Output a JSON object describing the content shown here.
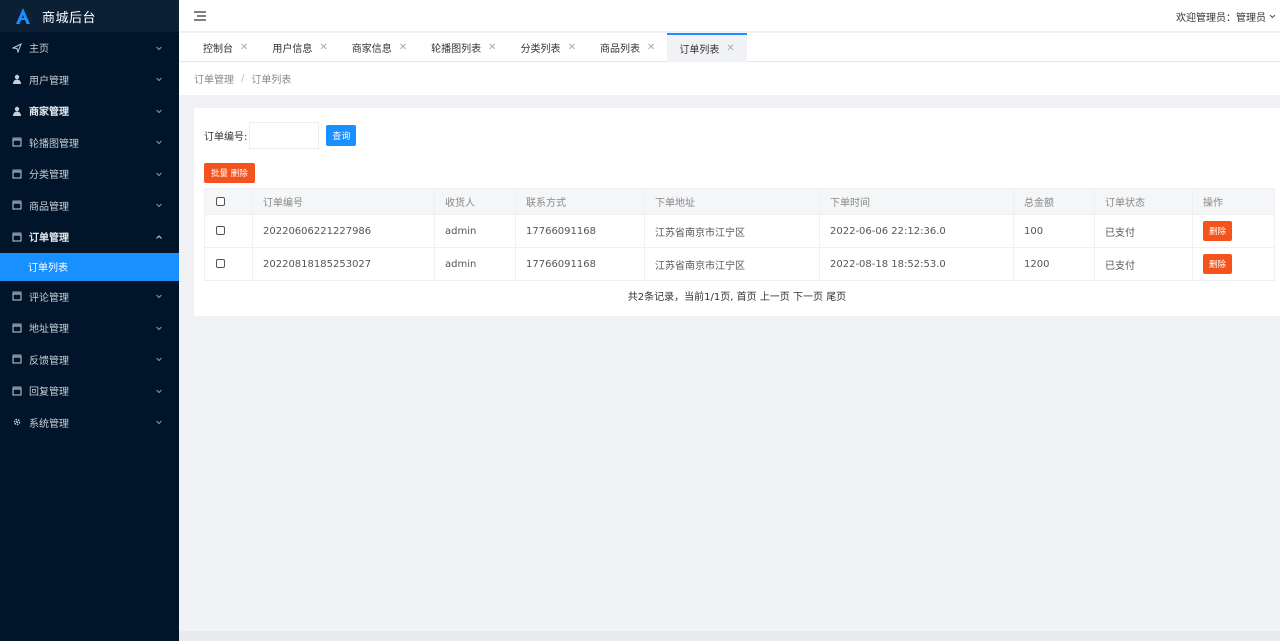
{
  "app": {
    "title": "商城后台"
  },
  "sidebar": {
    "items": [
      {
        "label": "主页",
        "icon": "send-icon",
        "bold": false,
        "arrow": "down"
      },
      {
        "label": "用户管理",
        "icon": "user-icon",
        "bold": false,
        "arrow": "down"
      },
      {
        "label": "商家管理",
        "icon": "user-icon",
        "bold": true,
        "arrow": "down"
      },
      {
        "label": "轮播图管理",
        "icon": "clapper-icon",
        "bold": false,
        "arrow": "down"
      },
      {
        "label": "分类管理",
        "icon": "clapper-icon",
        "bold": false,
        "arrow": "down"
      },
      {
        "label": "商品管理",
        "icon": "clapper-icon",
        "bold": false,
        "arrow": "down"
      },
      {
        "label": "订单管理",
        "icon": "clapper-icon",
        "bold": true,
        "arrow": "up"
      },
      {
        "label": "评论管理",
        "icon": "clapper-icon",
        "bold": false,
        "arrow": "down"
      },
      {
        "label": "地址管理",
        "icon": "clapper-icon",
        "bold": false,
        "arrow": "down"
      },
      {
        "label": "反馈管理",
        "icon": "clapper-icon",
        "bold": false,
        "arrow": "down"
      },
      {
        "label": "回复管理",
        "icon": "clapper-icon",
        "bold": false,
        "arrow": "down"
      },
      {
        "label": "系统管理",
        "icon": "gear-icon",
        "bold": false,
        "arrow": "down"
      }
    ],
    "active_sub": "订单列表"
  },
  "header": {
    "welcome": "欢迎管理员：管理员"
  },
  "tabs": [
    {
      "label": "控制台",
      "active": false
    },
    {
      "label": "用户信息",
      "active": false
    },
    {
      "label": "商家信息",
      "active": false
    },
    {
      "label": "轮播图列表",
      "active": false
    },
    {
      "label": "分类列表",
      "active": false
    },
    {
      "label": "商品列表",
      "active": false
    },
    {
      "label": "订单列表",
      "active": true
    }
  ],
  "breadcrumb": {
    "parent": "订单管理",
    "current": "订单列表",
    "sep": "/"
  },
  "search": {
    "label": "订单编号:",
    "value": "",
    "placeholder": "",
    "button": "查询"
  },
  "batch_delete": "批量 删除",
  "table": {
    "columns": [
      "订单编号",
      "收货人",
      "联系方式",
      "下单地址",
      "下单时间",
      "总金额",
      "订单状态",
      "操作"
    ],
    "rows": [
      {
        "order_no": "20220606221227986",
        "receiver": "admin",
        "phone": "17766091168",
        "address": "江苏省南京市江宁区",
        "time": "2022-06-06 22:12:36.0",
        "amount": "100",
        "status": "已支付",
        "action": "删除"
      },
      {
        "order_no": "20220818185253027",
        "receiver": "admin",
        "phone": "17766091168",
        "address": "江苏省南京市江宁区",
        "time": "2022-08-18 18:52:53.0",
        "amount": "1200",
        "status": "已支付",
        "action": "删除"
      }
    ]
  },
  "pager": {
    "summary": "共2条记录，当前1/1页,",
    "first": "首页",
    "prev": "上一页",
    "next": "下一页",
    "last": "尾页"
  },
  "colors": {
    "sidebar_bg": "#001529",
    "accent": "#1890ff",
    "danger": "#f5531e"
  }
}
